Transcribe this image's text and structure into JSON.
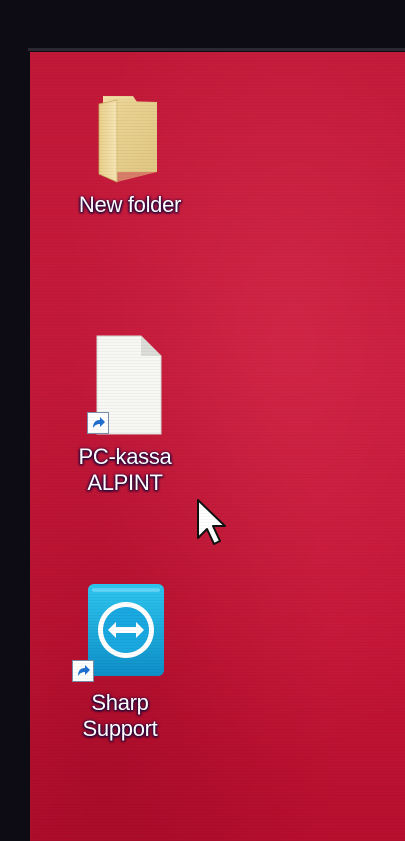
{
  "desktop": {
    "background_color": "#c71a3a",
    "icons": [
      {
        "label": "New folder",
        "icon": "folder-icon"
      },
      {
        "label": "PC-kassa\nALPINT",
        "icon": "file-shortcut-icon"
      },
      {
        "label": "Sharp\nSupport",
        "icon": "teamviewer-icon"
      }
    ]
  },
  "cursor": {
    "icon": "pointer-cursor-icon"
  }
}
